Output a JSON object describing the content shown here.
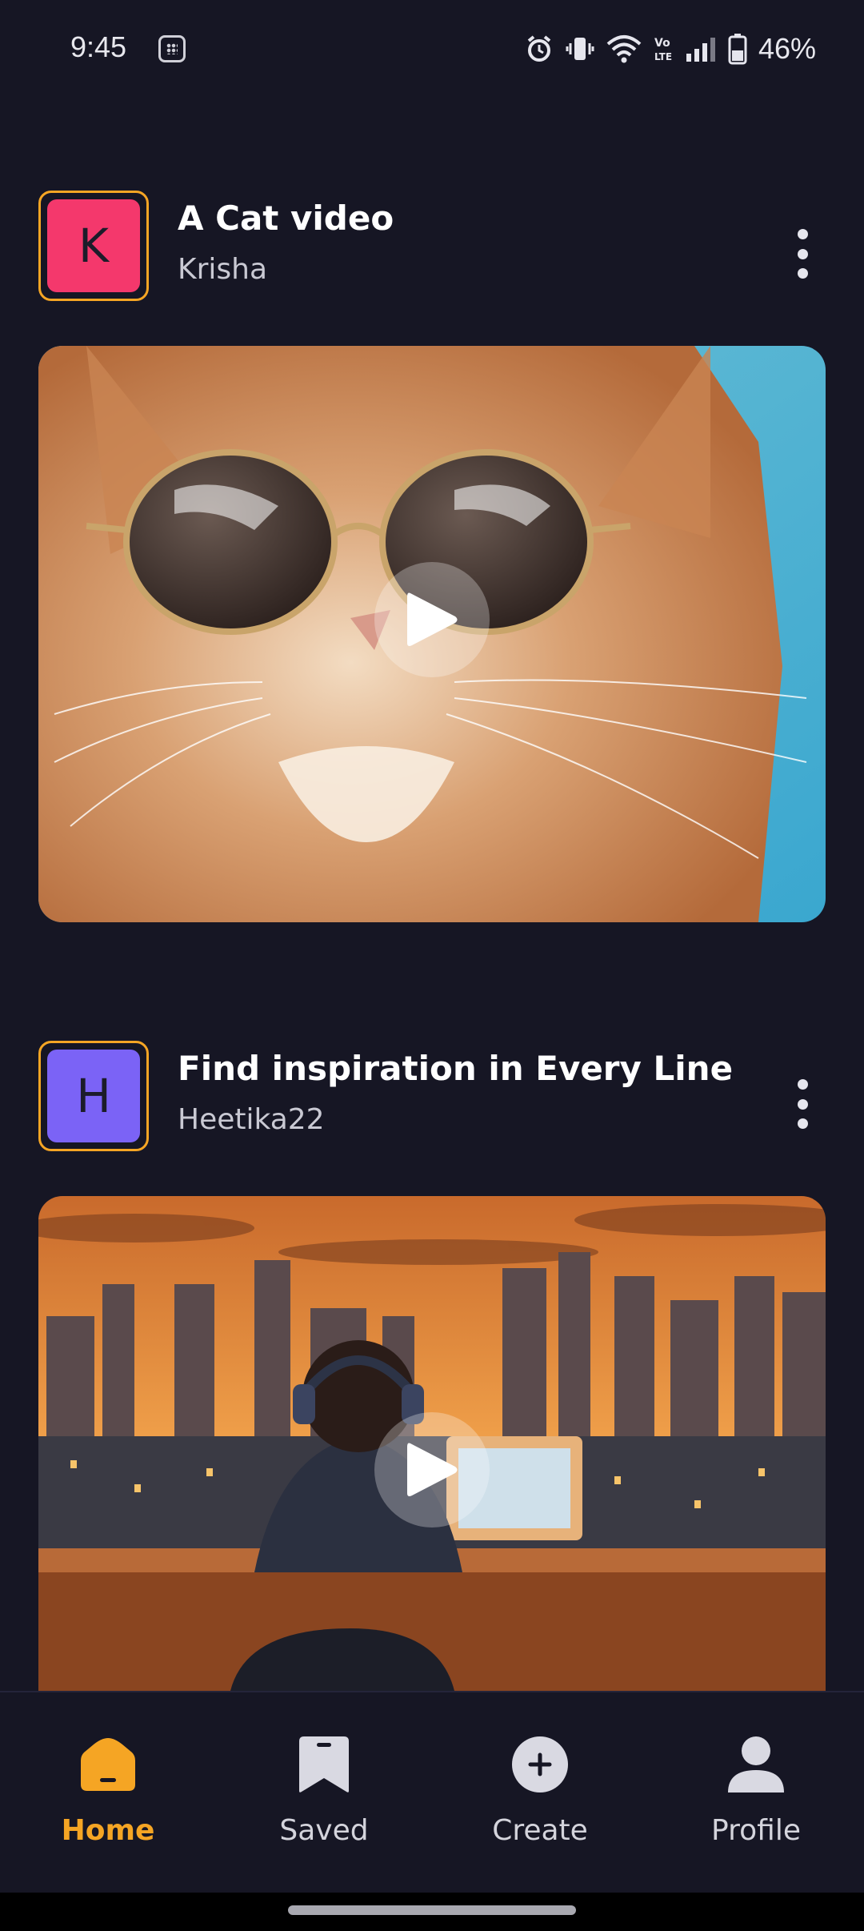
{
  "status_bar": {
    "time": "9:45",
    "battery": "46%",
    "icons": [
      "app-grid-icon",
      "alarm-icon",
      "vibrate-icon",
      "wifi-icon",
      "volte-icon",
      "signal-icon",
      "battery-icon"
    ]
  },
  "posts": [
    {
      "avatar_letter": "K",
      "avatar_color": "#f4386c",
      "title": "A Cat video",
      "author": "Krisha",
      "media_description": "cat-with-sunglasses-thumbnail"
    },
    {
      "avatar_letter": "H",
      "avatar_color": "#7b63f6",
      "title": "Find inspiration in Every Line",
      "author": "Heetika22",
      "media_description": "person-with-headphones-city-sunset-thumbnail"
    }
  ],
  "nav": {
    "items": [
      {
        "label": "Home",
        "icon": "home-icon",
        "active": true
      },
      {
        "label": "Saved",
        "icon": "bookmark-icon",
        "active": false
      },
      {
        "label": "Create",
        "icon": "plus-circle-icon",
        "active": false
      },
      {
        "label": "Profile",
        "icon": "person-icon",
        "active": false
      }
    ]
  },
  "colors": {
    "background": "#161624",
    "accent": "#f5a524"
  }
}
